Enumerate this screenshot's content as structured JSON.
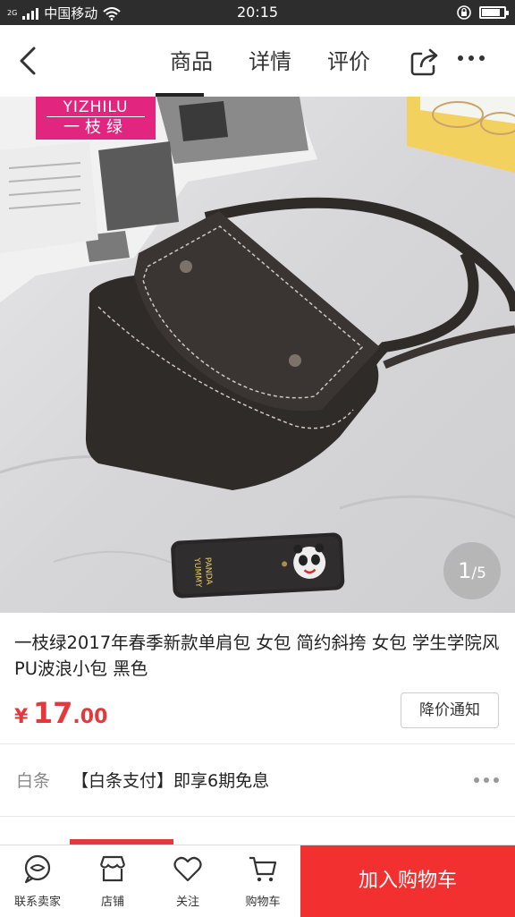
{
  "status_bar": {
    "network_type": "2G",
    "carrier": "中国移动",
    "time": "20:15",
    "battery_level": 0.85
  },
  "nav": {
    "tabs": [
      {
        "label": "商品",
        "active": true
      },
      {
        "label": "详情",
        "active": false
      },
      {
        "label": "评价",
        "active": false
      }
    ],
    "icons": [
      "back-arrow-icon",
      "share-icon",
      "more-icon"
    ]
  },
  "gallery": {
    "brand_logo_en": "YIZHILU",
    "brand_logo_cn": "一枝绿",
    "current": "1",
    "total": "/5"
  },
  "product": {
    "title": "一枝绿2017年春季新款单肩包 女包 简约斜挎 女包 学生学院风PU波浪小包 黑色",
    "price_symbol": "¥",
    "price_integer": "17",
    "price_decimal": ".00",
    "notify_label": "降价通知"
  },
  "baitiao": {
    "label": "白条",
    "text": "【白条支付】即享6期免息"
  },
  "bottom_bar": {
    "items": [
      {
        "label": "联系卖家",
        "icon": "chat-icon"
      },
      {
        "label": "店铺",
        "icon": "store-icon"
      },
      {
        "label": "关注",
        "icon": "heart-icon"
      },
      {
        "label": "购物车",
        "icon": "cart-icon"
      }
    ],
    "add_to_cart": "加入购物车"
  },
  "colors": {
    "accent": "#e4393c",
    "cart_button": "#f23030",
    "brand_pink": "#e2267f",
    "status_bar": "#2d2d2d"
  }
}
